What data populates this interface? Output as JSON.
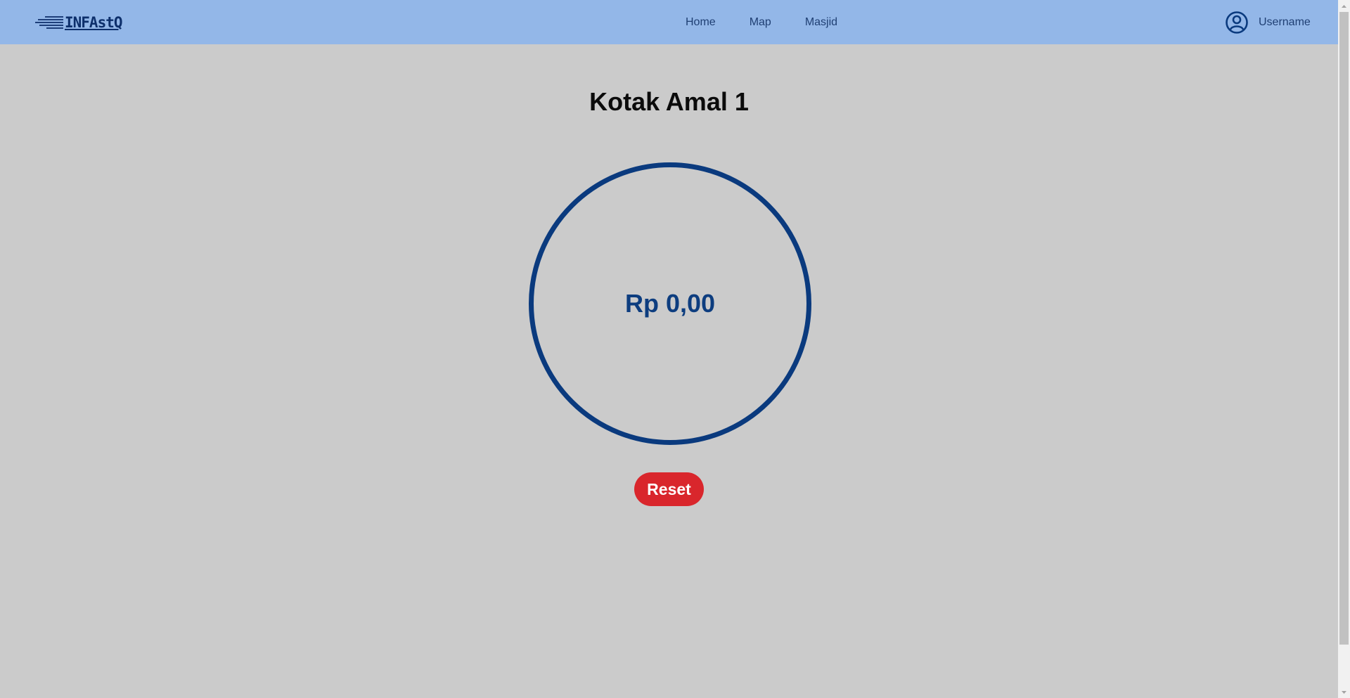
{
  "navbar": {
    "logo_text": "INFAstQ",
    "links": [
      {
        "label": "Home"
      },
      {
        "label": "Map"
      },
      {
        "label": "Masjid"
      }
    ],
    "user": {
      "icon": "user-circle-icon",
      "name": "Username"
    }
  },
  "main": {
    "title": "Kotak Amal 1",
    "amount": "Rp 0,00",
    "reset_label": "Reset"
  },
  "colors": {
    "navbar_bg": "#93b7e8",
    "page_bg": "#cbcbcb",
    "accent_blue": "#0a3a7e",
    "reset_red": "#d9262c"
  }
}
